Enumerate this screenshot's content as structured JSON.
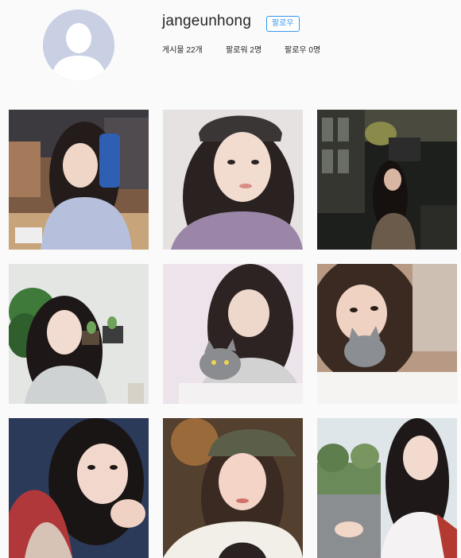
{
  "profile": {
    "username": "jangeunhong",
    "follow_label": "팔로우",
    "stats": {
      "posts": "게시물 22개",
      "followers": "팔로워 2명",
      "following": "팔로우 0명"
    }
  },
  "colors": {
    "accent": "#3897f0",
    "avatar_bg": "#c9d0e3"
  },
  "grid": {
    "posts": [
      {
        "scene": "cafe-blue-drink"
      },
      {
        "scene": "beanie-portrait"
      },
      {
        "scene": "night-terrace"
      },
      {
        "scene": "plants-portrait"
      },
      {
        "scene": "cat-hug"
      },
      {
        "scene": "cat-bed-selfie"
      },
      {
        "scene": "chin-rest-selfie"
      },
      {
        "scene": "cap-selfie"
      },
      {
        "scene": "street-portrait"
      }
    ]
  }
}
